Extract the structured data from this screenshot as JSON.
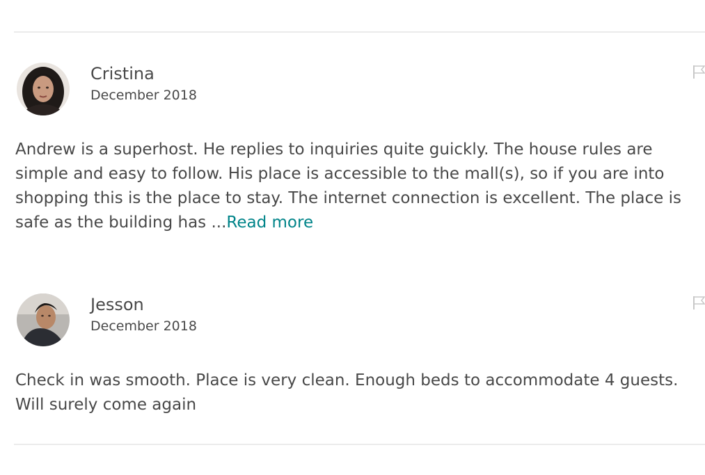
{
  "reviews": [
    {
      "author": "Cristina",
      "date": "December 2018",
      "text": "Andrew is a superhost. He replies to inquiries quite guickly. The house rules are simple and easy to follow. His place is accessible to the mall(s), so if you are into shopping this is the place to stay. The internet connection is excellent. The place is safe as the building has ...",
      "read_more_label": "Read more",
      "avatar_icon": "profile-photo",
      "flag_icon": "flag-icon"
    },
    {
      "author": "Jesson",
      "date": "December 2018",
      "text": "Check in was smooth. Place is very clean. Enough beds to accommodate 4 guests. Will surely come again",
      "avatar_icon": "profile-photo",
      "flag_icon": "flag-icon"
    }
  ],
  "colors": {
    "text": "#484848",
    "link": "#008489",
    "divider": "#ebebeb",
    "flag": "#c8c8c8"
  }
}
